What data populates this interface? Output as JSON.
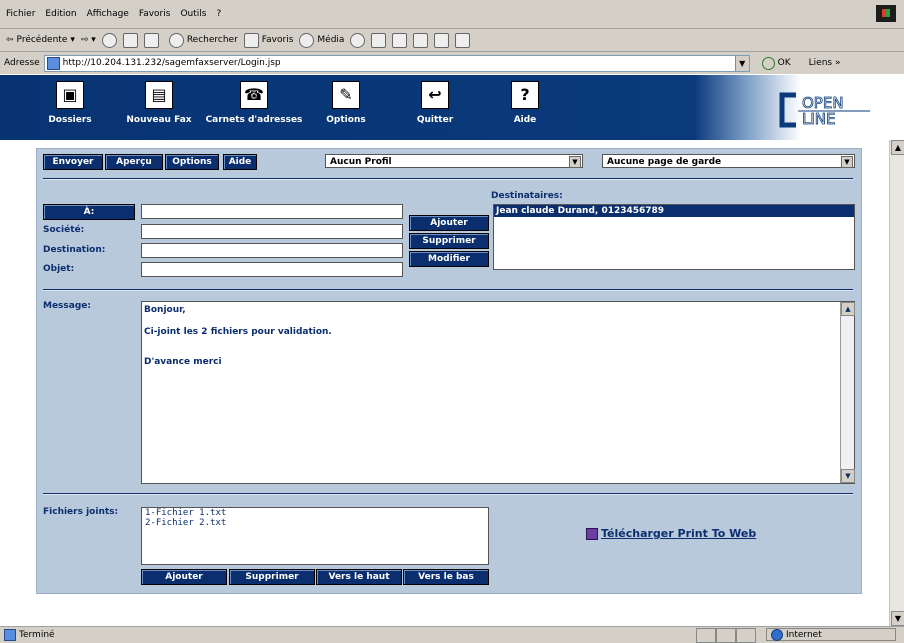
{
  "browser": {
    "menu": [
      "Fichier",
      "Edition",
      "Affichage",
      "Favoris",
      "Outils",
      "?"
    ],
    "toolbar": {
      "back": "Précédente",
      "search": "Rechercher",
      "favorites": "Favoris",
      "media": "Média"
    },
    "address_label": "Adresse",
    "url": "http://10.204.131.232/sagemfaxserver/Login.jsp",
    "go_label": "OK",
    "links_label": "Liens »",
    "status_left": "Terminé",
    "status_zone": "Internet"
  },
  "nav": [
    {
      "label": "Dossiers",
      "icon": "folder-icon",
      "glyph": "▣"
    },
    {
      "label": "Nouveau Fax",
      "icon": "fax-icon",
      "glyph": "▤"
    },
    {
      "label": "Carnets d'adresses",
      "icon": "phone-icon",
      "glyph": "☎"
    },
    {
      "label": "Options",
      "icon": "wrench-icon",
      "glyph": "✎"
    },
    {
      "label": "Quitter",
      "icon": "exit-icon",
      "glyph": "↩"
    },
    {
      "label": "Aide",
      "icon": "help-icon",
      "glyph": "?"
    }
  ],
  "logo": {
    "line1": "OPEN",
    "line2": "LINE"
  },
  "form": {
    "actions": {
      "send": "Envoyer",
      "preview": "Aperçu",
      "options": "Options",
      "help": "Aide"
    },
    "profile_select": "Aucun Profil",
    "cover_select": "Aucune page de garde",
    "to_button": "À:",
    "fields": {
      "company": "Société:",
      "destination": "Destination:",
      "subject": "Objet:"
    },
    "recipient_buttons": {
      "add": "Ajouter",
      "remove": "Supprimer",
      "edit": "Modifier"
    },
    "recipients_label": "Destinataires:",
    "recipients": [
      "Jean claude Durand, 0123456789"
    ],
    "message_label": "Message:",
    "message_lines": [
      "Bonjour,",
      "Ci-joint les 2 fichiers pour validation.",
      "D'avance merci"
    ],
    "attachments_label": "Fichiers joints:",
    "attachments": [
      "1-Fichier 1.txt",
      "2-Fichier 2.txt"
    ],
    "attachment_buttons": {
      "add": "Ajouter",
      "remove": "Supprimer",
      "up": "Vers le haut",
      "down": "Vers le bas"
    },
    "download_link": "Télécharger Print To Web"
  },
  "colors": {
    "navy": "#0a2e6e",
    "panel": "#b9c9dc"
  }
}
